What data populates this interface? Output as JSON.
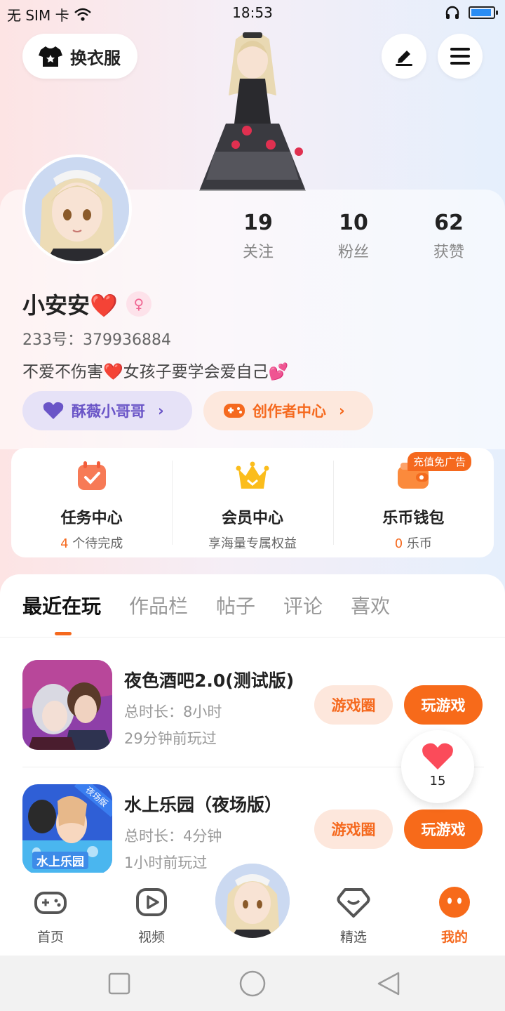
{
  "status_bar": {
    "carrier": "无 SIM 卡",
    "time": "18:53"
  },
  "header": {
    "outfit_label": "换衣服"
  },
  "profile": {
    "stats": [
      {
        "num": "19",
        "label": "关注"
      },
      {
        "num": "10",
        "label": "粉丝"
      },
      {
        "num": "62",
        "label": "获赞"
      }
    ],
    "name": "小安安❤️",
    "uid": "233号：379936884",
    "bio": "不爱不伤害❤️女孩子要学会爱自己💕",
    "chip_a": "酥薇小哥哥",
    "chip_b": "创作者中心"
  },
  "quick": {
    "task": {
      "title": "任务中心",
      "count": "4",
      "sub": " 个待完成"
    },
    "vip": {
      "title": "会员中心",
      "sub": "享海量专属权益"
    },
    "wallet": {
      "title": "乐币钱包",
      "count": "0",
      "sub": " 乐币",
      "badge": "充值免广告"
    }
  },
  "tabs": [
    "最近在玩",
    "作品栏",
    "帖子",
    "评论",
    "喜欢"
  ],
  "games": [
    {
      "title": "夜色酒吧2.0(测试版)",
      "duration": "总时长：8小时",
      "last": "29分钟前玩过",
      "circle": "游戏圈",
      "play": "玩游戏"
    },
    {
      "title": "水上乐园（夜场版）",
      "duration": "总时长：4分钟",
      "last": "1小时前玩过",
      "circle": "游戏圈",
      "play": "玩游戏",
      "thumb_badge": "夜场版",
      "thumb_text": "水上乐园"
    }
  ],
  "like_count": "15",
  "nav": {
    "home": "首页",
    "video": "视频",
    "featured": "精选",
    "mine": "我的"
  },
  "colors": {
    "accent": "#f5691e",
    "purple": "#6a55c7"
  }
}
